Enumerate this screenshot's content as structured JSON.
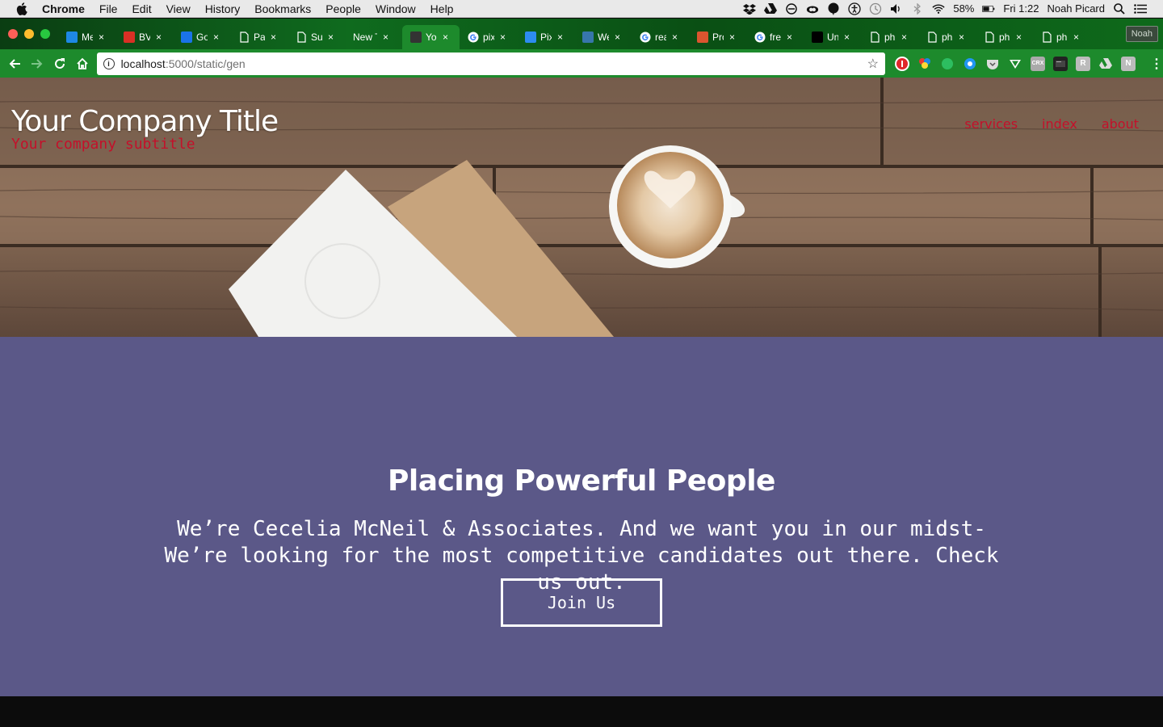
{
  "menubar": {
    "app": "Chrome",
    "items": [
      "File",
      "Edit",
      "View",
      "History",
      "Bookmarks",
      "People",
      "Window",
      "Help"
    ],
    "battery": "58%",
    "clock": "Fri 1:22",
    "user": "Noah Picard"
  },
  "tabs": [
    {
      "title": "Me",
      "icon": "messenger-icon",
      "color": "#1e88e5"
    },
    {
      "title": "BV",
      "icon": "gmail-icon",
      "color": "#d93025"
    },
    {
      "title": "Go",
      "icon": "calendar-icon",
      "color": "#1a73e8"
    },
    {
      "title": "Pa",
      "icon": "page-icon",
      "color": "#ffffff"
    },
    {
      "title": "Sul",
      "icon": "page-icon",
      "color": "#ffffff"
    },
    {
      "title": "New T",
      "icon": "none",
      "color": "#ffffff"
    },
    {
      "title": "You",
      "icon": "terminal-icon",
      "color": "#333333",
      "active": true
    },
    {
      "title": "pix",
      "icon": "google-icon",
      "color": "#ffffff"
    },
    {
      "title": "Pix",
      "icon": "pixlr-icon",
      "color": "#2d8cf0"
    },
    {
      "title": "We",
      "icon": "python-icon",
      "color": "#3776ab"
    },
    {
      "title": "rea",
      "icon": "google-icon",
      "color": "#ffffff"
    },
    {
      "title": "Pro",
      "icon": "producthunt-icon",
      "color": "#da552f"
    },
    {
      "title": "fre",
      "icon": "google-icon",
      "color": "#ffffff"
    },
    {
      "title": "Un",
      "icon": "unsplash-icon",
      "color": "#000000"
    },
    {
      "title": "ph",
      "icon": "page-icon",
      "color": "#ffffff"
    },
    {
      "title": "ph",
      "icon": "page-icon",
      "color": "#ffffff"
    },
    {
      "title": "ph",
      "icon": "page-icon",
      "color": "#ffffff"
    },
    {
      "title": "ph",
      "icon": "page-icon",
      "color": "#ffffff"
    }
  ],
  "profile_button": "Noah",
  "omnibox": {
    "host": "localhost",
    "path": ":5000/static/gen"
  },
  "site": {
    "title": "Your Company Title",
    "subtitle": "Your company subtitle",
    "nav": [
      "services",
      "index",
      "about"
    ],
    "heading": "Placing Powerful People",
    "body": "We’re Cecelia McNeil & Associates. And we want you in our midst- We’re looking for the most competitive candidates out there. Check us out.",
    "cta": "Join Us"
  },
  "colors": {
    "accent_red": "#c4102a",
    "section_bg": "#5b5888",
    "chrome_green": "#1d8a2c"
  }
}
